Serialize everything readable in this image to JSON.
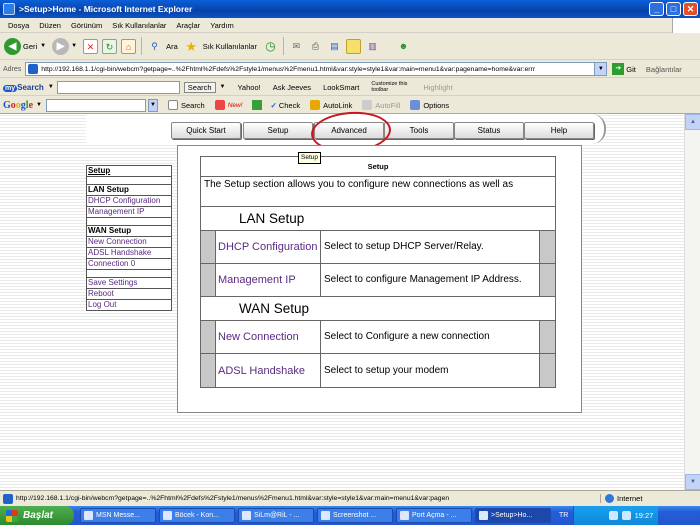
{
  "window": {
    "title": ">Setup>Home - Microsoft Internet Explorer",
    "min_glyph": "_",
    "max_glyph": "□",
    "close_glyph": "✕"
  },
  "menu": [
    "Dosya",
    "Düzen",
    "Görünüm",
    "Sık Kullanılanlar",
    "Araçlar",
    "Yardım"
  ],
  "toolbar": {
    "back_label": "Geri",
    "search_label": "Ara",
    "favorites_label": "Sık Kullanılanlar"
  },
  "address": {
    "label": "Adres",
    "url": "http://192.168.1.1/cgi-bin/webcm?getpage=..%2Fhtml%2Fdefs%2Fstyle1/menus%2Fmenu1.html&var:style=style1&var:main=menu1&var:pagename=home&var:errr",
    "go_label": "Git",
    "links_label": "Bağlantılar"
  },
  "mysearch": {
    "logo_my": "my",
    "logo_text": "Search",
    "search_button": "Search",
    "items": [
      "Yahoo!",
      "Ask Jeeves",
      "LookSmart"
    ],
    "customize": "Customize this toolbar",
    "highlight": "Highlight"
  },
  "googlebar": {
    "search_label": "Search",
    "new_badge": "New!",
    "check_label": "Check",
    "autolink_label": "AutoLink",
    "autofill_label": "AutoFill",
    "options_label": "Options"
  },
  "nav": {
    "tabs": [
      "Quick Start",
      "Setup",
      "Advanced",
      "Tools",
      "Status",
      "Help"
    ],
    "tooltip": "Setup"
  },
  "sidebar": {
    "title": "Setup",
    "lan_header": "LAN Setup",
    "lan_items": [
      "DHCP Configuration",
      "Management IP"
    ],
    "wan_header": "WAN Setup",
    "wan_items": [
      "New Connection",
      "ADSL Handshake",
      "Connection 0"
    ],
    "bottom_items": [
      "Save Settings",
      "Reboot",
      "Log Out"
    ]
  },
  "main": {
    "title": "Setup",
    "description": "The Setup section allows you to configure new connections as well as",
    "lan_section": "LAN Setup",
    "lan_rows": [
      {
        "link": "DHCP Configuration",
        "desc": "Select to setup DHCP Server/Relay."
      },
      {
        "link": "Management IP",
        "desc": "Select to configure Management IP Address."
      }
    ],
    "wan_section": "WAN Setup",
    "wan_rows": [
      {
        "link": "New Connection",
        "desc": "Select to Configure a new connection"
      },
      {
        "link": "ADSL Handshake",
        "desc": "Select to setup your modem"
      }
    ]
  },
  "status": {
    "url": "http://192.168.1.1/cgi-bin/webcm?getpage=..%2Fhtml%2Fdefs%2Fstyle1/menus%2Fmenu1.html&var:style=style1&var:main=menu1&var:pagen",
    "zone": "Internet"
  },
  "taskbar": {
    "start_label": "Başlat",
    "tasks": [
      "MSN Messe...",
      "Böcek - Kon...",
      "SiLm@RiL - ...",
      "Screenshot ...",
      "Port Açma - ...",
      ">Setup>Ho..."
    ],
    "language": "TR",
    "clock": "19:27"
  },
  "colors": {
    "link_purple": "#5a2a82",
    "annotation_red": "#c8171e",
    "title_bar_blue": "#0842a8",
    "start_green": "#2e8a2e"
  }
}
